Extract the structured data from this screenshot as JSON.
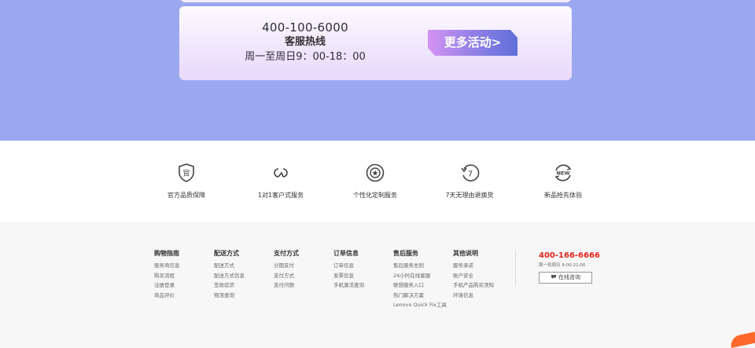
{
  "promo": {
    "phone": "400-100-6000",
    "service_label": "客服热线",
    "hours": "周一至周日9：00-18：00",
    "more_button": "更多活动>"
  },
  "services": [
    {
      "label": "官方品质保障",
      "icon": "shield-official-icon"
    },
    {
      "label": "1对1客户式服务",
      "icon": "one-to-one-service-icon"
    },
    {
      "label": "个性化定制服务",
      "icon": "custom-service-icon"
    },
    {
      "label": "7天无理由退换货",
      "icon": "seven-day-return-icon"
    },
    {
      "label": "新品抢先体验",
      "icon": "new-product-icon"
    }
  ],
  "footer": {
    "columns": [
      {
        "title": "购物指南",
        "items": [
          "服务商信息",
          "购买流程",
          "注册登录",
          "商品评价"
        ]
      },
      {
        "title": "配送方式",
        "items": [
          "配送方式",
          "配送方式信息",
          "签收验货",
          "物流查询"
        ]
      },
      {
        "title": "支付方式",
        "items": [
          "分期支付",
          "支付方式",
          "支付问题"
        ]
      },
      {
        "title": "订单信息",
        "items": [
          "订单信息",
          "发票信息",
          "手机激活查询"
        ]
      },
      {
        "title": "售后服务",
        "items": [
          "售后服务总则",
          "24小时在线客服",
          "联想服务入口",
          "热门解决方案",
          "Lenovo Quick Fix工具"
        ]
      },
      {
        "title": "其他说明",
        "items": [
          "服务承诺",
          "账户安全",
          "手机产品购买须知",
          "环境信息"
        ]
      }
    ],
    "contact": {
      "phone": "400-166-6666",
      "hours": "周一到周日 9:00-21:00",
      "chat_button": "在线咨询"
    }
  },
  "colors": {
    "banner_bg": "#9ba8ef",
    "hotline_red": "#e1251b",
    "button_gradient_start": "#d493f2",
    "button_gradient_end": "#5f6fd8"
  }
}
